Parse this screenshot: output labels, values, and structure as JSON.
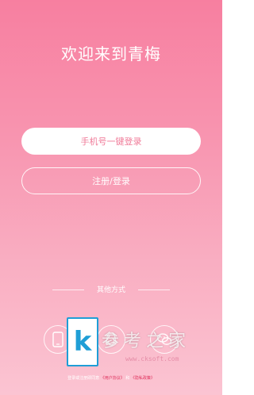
{
  "header": {
    "title": "欢迎来到青梅"
  },
  "actions": {
    "one_click_login_label": "手机号一键登录",
    "register_login_label": "注册/登录"
  },
  "other_methods": {
    "label": "其他方式",
    "icons": [
      "phone-icon",
      "qq-icon",
      "wechat-icon"
    ]
  },
  "agreement": {
    "prefix": "登录或注册即同意",
    "user_agreement": "《用户协议》",
    "conjunction": "和",
    "privacy_policy": "《隐私政策》"
  },
  "watermark": {
    "logo_letter": "k",
    "text": "参考之家",
    "url": "www.cksoft.com"
  },
  "colors": {
    "gradient_top": "#f77fa0",
    "gradient_bottom": "#fbc4d2",
    "button_text": "#f07b99",
    "link": "#e0315c"
  }
}
